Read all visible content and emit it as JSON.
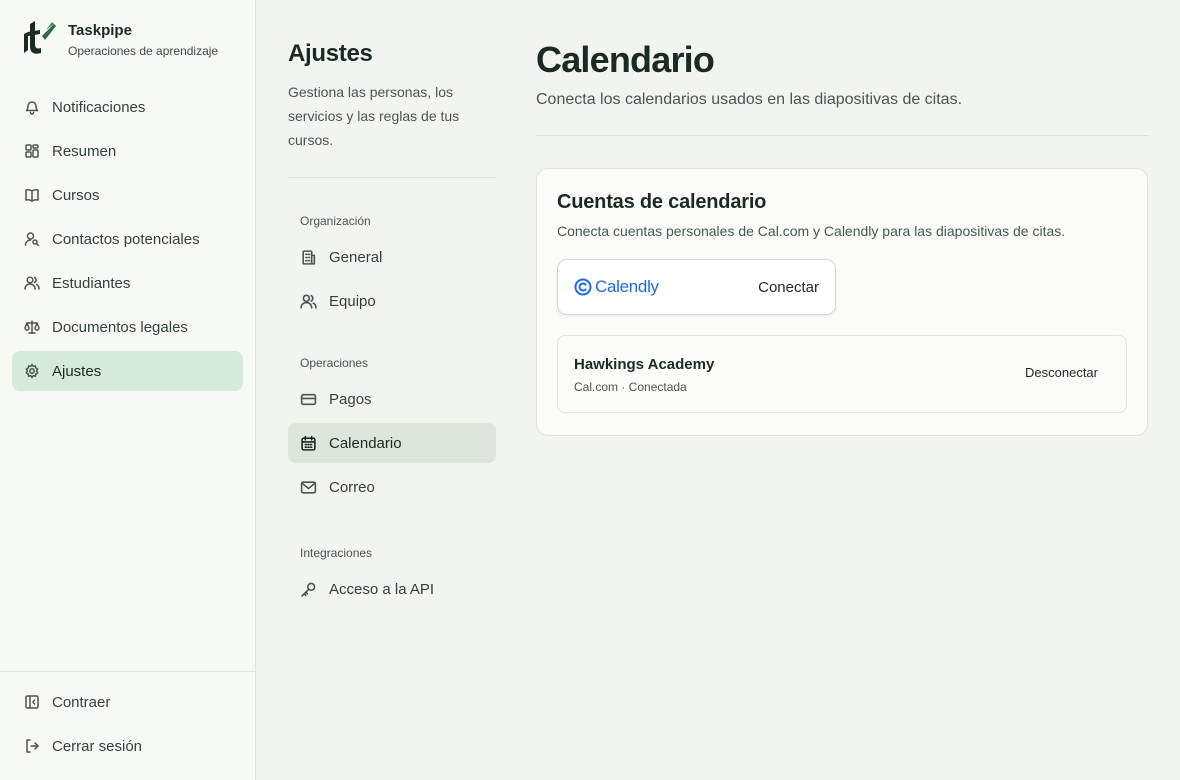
{
  "brand": {
    "name": "Taskpipe",
    "subtitle": "Operaciones de aprendizaje",
    "accent": "#2f6b4a"
  },
  "sidebar": {
    "items": [
      {
        "label": "Notificaciones",
        "icon": "bell-icon"
      },
      {
        "label": "Resumen",
        "icon": "dashboard-icon"
      },
      {
        "label": "Cursos",
        "icon": "book-icon"
      },
      {
        "label": "Contactos potenciales",
        "icon": "user-search-icon"
      },
      {
        "label": "Estudiantes",
        "icon": "users-icon"
      },
      {
        "label": "Documentos legales",
        "icon": "scale-icon"
      },
      {
        "label": "Ajustes",
        "icon": "gear-icon",
        "active": true
      }
    ],
    "bottom": [
      {
        "label": "Contraer",
        "icon": "collapse-icon"
      },
      {
        "label": "Cerrar sesión",
        "icon": "logout-icon"
      }
    ]
  },
  "settings": {
    "title": "Ajustes",
    "description": "Gestiona las personas, los servicios y las reglas de tus cursos.",
    "groups": [
      {
        "label": "Organización",
        "items": [
          {
            "label": "General",
            "icon": "building-icon"
          },
          {
            "label": "Equipo",
            "icon": "users-icon"
          }
        ]
      },
      {
        "label": "Operaciones",
        "items": [
          {
            "label": "Pagos",
            "icon": "credit-card-icon"
          },
          {
            "label": "Calendario",
            "icon": "calendar-icon",
            "active": true
          },
          {
            "label": "Correo",
            "icon": "mail-icon"
          }
        ]
      },
      {
        "label": "Integraciones",
        "items": [
          {
            "label": "Acceso a la API",
            "icon": "key-icon"
          }
        ]
      }
    ]
  },
  "main": {
    "title": "Calendario",
    "subtitle": "Conecta los calendarios usados en las diapositivas de citas.",
    "card": {
      "title": "Cuentas de calendario",
      "description": "Conecta cuentas personales de Cal.com y Calendly para las diapositivas de citas.",
      "provider": {
        "name": "Calendly",
        "action": "Conectar",
        "brand_color": "#1a6be3"
      },
      "account": {
        "name": "Hawkings Academy",
        "meta": "Cal.com · Conectada",
        "action": "Desconectar"
      }
    }
  }
}
